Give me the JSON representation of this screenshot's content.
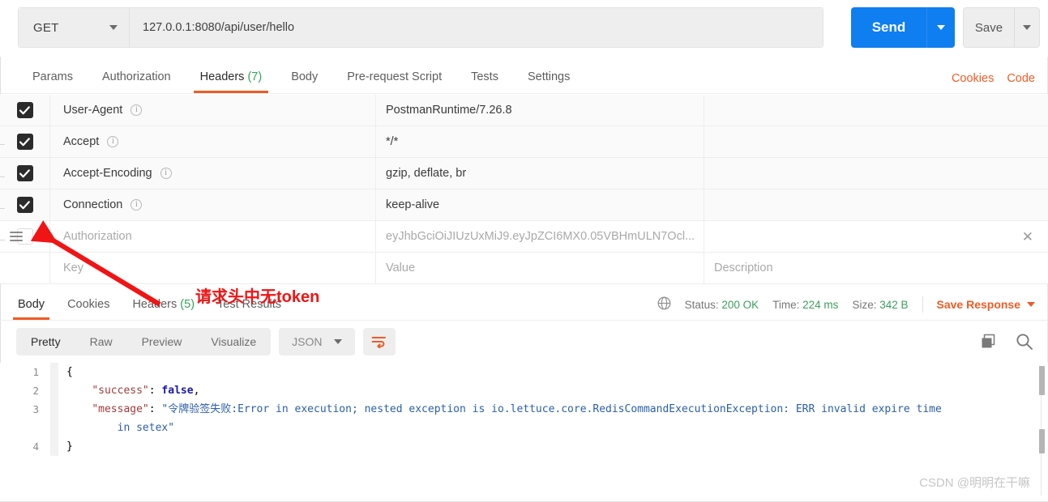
{
  "request": {
    "method": "GET",
    "url": "127.0.0.1:8080/api/user/hello",
    "send_label": "Send",
    "save_label": "Save",
    "tabs": [
      {
        "label": "Params",
        "count": "",
        "active": false
      },
      {
        "label": "Authorization",
        "count": "",
        "active": false
      },
      {
        "label": "Headers",
        "count": "(7)",
        "active": true
      },
      {
        "label": "Body",
        "count": "",
        "active": false
      },
      {
        "label": "Pre-request Script",
        "count": "",
        "active": false
      },
      {
        "label": "Tests",
        "count": "",
        "active": false
      },
      {
        "label": "Settings",
        "count": "",
        "active": false
      }
    ],
    "links": {
      "cookies": "Cookies",
      "code": "Code"
    }
  },
  "headers_table": {
    "placeholder_key": "Key",
    "placeholder_value": "Value",
    "placeholder_description": "Description",
    "rows": [
      {
        "checked": true,
        "key": "User-Agent",
        "value": "PostmanRuntime/7.26.8",
        "description": ""
      },
      {
        "checked": true,
        "key": "Accept",
        "value": "*/*",
        "description": ""
      },
      {
        "checked": true,
        "key": "Accept-Encoding",
        "value": "gzip, deflate, br",
        "description": ""
      },
      {
        "checked": true,
        "key": "Connection",
        "value": "keep-alive",
        "description": ""
      },
      {
        "checked": false,
        "key": "Authorization",
        "value": "eyJhbGciOiJIUzUxMiJ9.eyJpZCI6MX0.05VBHmULN7Ocl...",
        "description": ""
      }
    ]
  },
  "response": {
    "tabs": [
      {
        "label": "Body",
        "count": "",
        "active": true
      },
      {
        "label": "Cookies",
        "count": "",
        "active": false
      },
      {
        "label": "Headers",
        "count": "(5)",
        "active": false
      },
      {
        "label": "Test Results",
        "count": "",
        "active": false
      }
    ],
    "status_label": "Status:",
    "status_value": "200 OK",
    "time_label": "Time:",
    "time_value": "224 ms",
    "size_label": "Size:",
    "size_value": "342 B",
    "save_response": "Save Response",
    "view_modes": [
      {
        "label": "Pretty",
        "active": true
      },
      {
        "label": "Raw",
        "active": false
      },
      {
        "label": "Preview",
        "active": false
      },
      {
        "label": "Visualize",
        "active": false
      }
    ],
    "format": "JSON",
    "body_lines": [
      {
        "num": "1",
        "indent": 0,
        "segments": [
          {
            "text": "{",
            "cls": "j-punct"
          }
        ]
      },
      {
        "num": "2",
        "indent": 1,
        "segments": [
          {
            "text": "\"success\"",
            "cls": "j-key"
          },
          {
            "text": ": ",
            "cls": "j-punct"
          },
          {
            "text": "false",
            "cls": "j-kw"
          },
          {
            "text": ",",
            "cls": "j-punct"
          }
        ]
      },
      {
        "num": "3",
        "indent": 1,
        "segments": [
          {
            "text": "\"message\"",
            "cls": "j-key"
          },
          {
            "text": ": ",
            "cls": "j-punct"
          },
          {
            "text": "\"令牌验签失败:Error in execution; nested exception is io.lettuce.core.RedisCommandExecutionException: ERR invalid expire time",
            "cls": "j-str"
          }
        ]
      },
      {
        "num": "",
        "indent": 2,
        "segments": [
          {
            "text": "in setex\"",
            "cls": "j-str"
          }
        ]
      },
      {
        "num": "4",
        "indent": 0,
        "segments": [
          {
            "text": "}",
            "cls": "j-punct"
          }
        ]
      }
    ]
  },
  "annotation": {
    "text": "请求头中无token",
    "color": "#f01414"
  },
  "watermark": "CSDN @明明在干嘛",
  "colors": {
    "accent_orange": "#ef5b25",
    "send_blue": "#0f7ef0",
    "status_green": "#35a35a"
  }
}
